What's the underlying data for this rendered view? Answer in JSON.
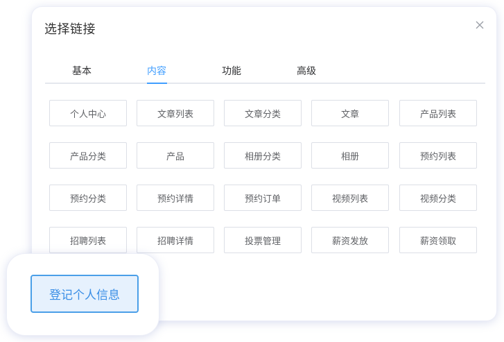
{
  "dialog": {
    "title": "选择链接",
    "close_icon": "close-icon"
  },
  "tabs": [
    {
      "label": "基本",
      "active": false
    },
    {
      "label": "内容",
      "active": true
    },
    {
      "label": "功能",
      "active": false
    },
    {
      "label": "高级",
      "active": false
    }
  ],
  "accent_color": "#409eff",
  "options": [
    [
      "个人中心",
      "文章列表",
      "文章分类",
      "文章",
      "产品列表"
    ],
    [
      "产品分类",
      "产品",
      "相册分类",
      "相册",
      "预约列表"
    ],
    [
      "预约分类",
      "预约详情",
      "预约订单",
      "视频列表",
      "视频分类"
    ],
    [
      "招聘列表",
      "招聘详情",
      "投票管理",
      "薪资发放",
      "薪资领取"
    ]
  ],
  "float_card": {
    "button_label": "登记个人信息"
  }
}
